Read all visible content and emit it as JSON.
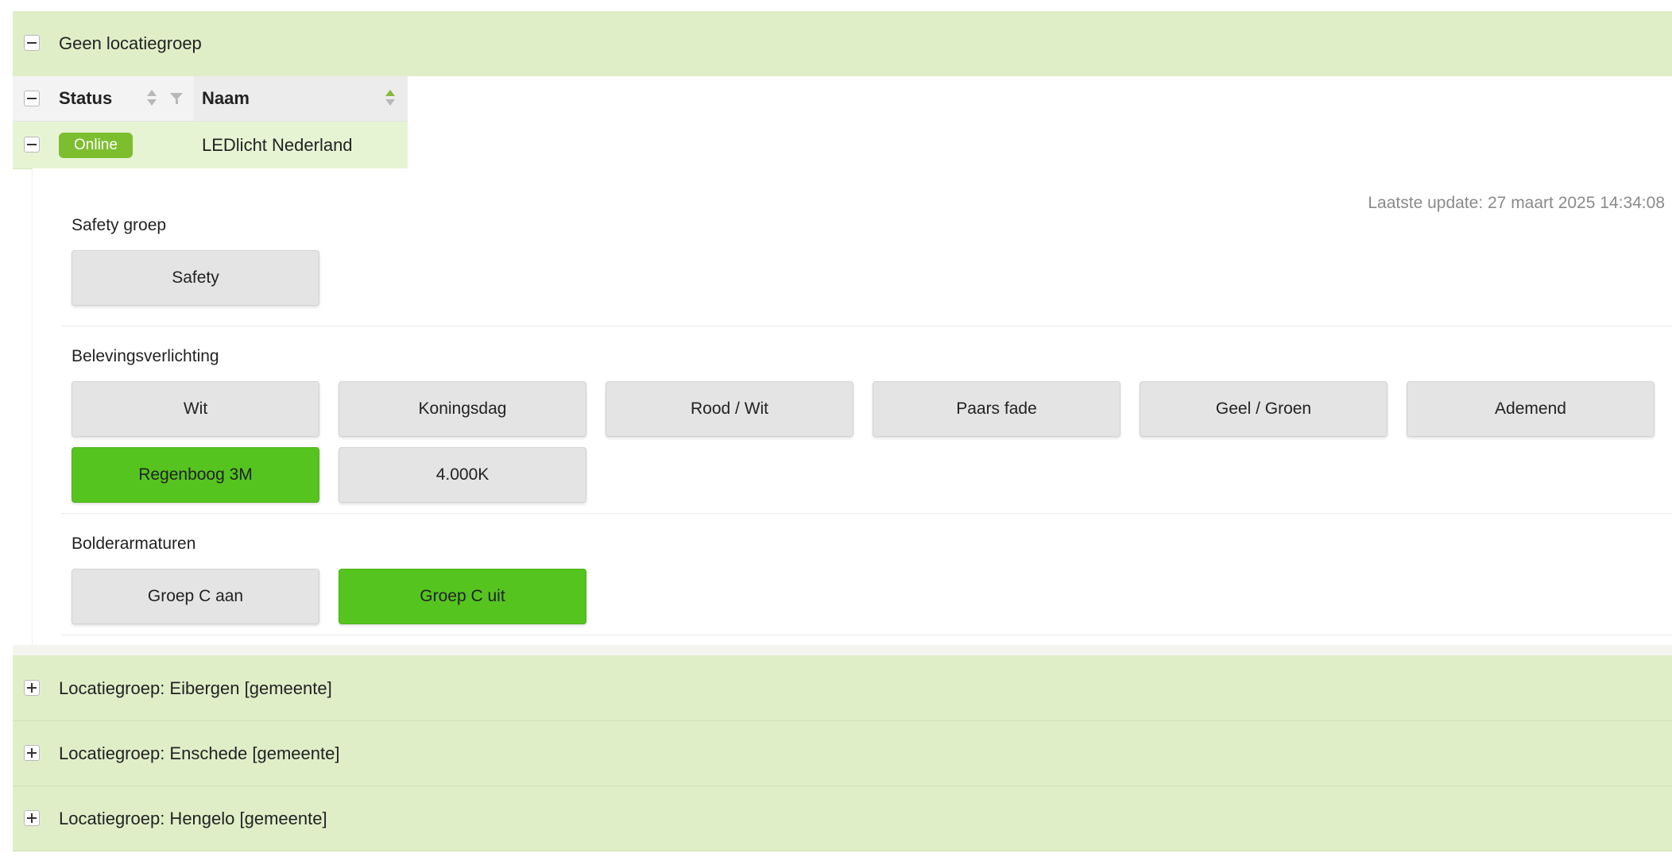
{
  "groups": {
    "expanded": {
      "title": "Geen locatiegroep"
    },
    "collapsed": [
      {
        "title": "Locatiegroep: Eibergen [gemeente]"
      },
      {
        "title": "Locatiegroep: Enschede [gemeente]"
      },
      {
        "title": "Locatiegroep: Hengelo [gemeente]"
      }
    ]
  },
  "grid": {
    "columns": [
      {
        "label": "Status"
      },
      {
        "label": "Naam"
      }
    ],
    "rows": [
      {
        "status": "Online",
        "name": "LEDlicht Nederland"
      }
    ]
  },
  "detail": {
    "last_update": "Laatste update: 27 maart 2025 14:34:08",
    "sections": [
      {
        "label": "Safety groep",
        "buttons": [
          {
            "label": "Safety",
            "active": false
          }
        ]
      },
      {
        "label": "Belevingsverlichting",
        "buttons": [
          {
            "label": "Wit",
            "active": false
          },
          {
            "label": "Koningsdag",
            "active": false
          },
          {
            "label": "Rood / Wit",
            "active": false
          },
          {
            "label": "Paars fade",
            "active": false
          },
          {
            "label": "Geel / Groen",
            "active": false
          },
          {
            "label": "Ademend",
            "active": false
          },
          {
            "label": "Regenboog 3M",
            "active": true
          },
          {
            "label": "4.000K",
            "active": false
          }
        ]
      },
      {
        "label": "Bolderarmaturen",
        "buttons": [
          {
            "label": "Groep C aan",
            "active": false
          },
          {
            "label": "Groep C uit",
            "active": true
          }
        ]
      }
    ]
  },
  "colors": {
    "group_header_bg": "#e0eec8",
    "row_bg": "#e6f4d4",
    "badge_bg": "#7dbe2e",
    "active_button_bg": "#55c41f",
    "button_bg": "#e4e4e4",
    "sort_active": "#86bb3a"
  }
}
